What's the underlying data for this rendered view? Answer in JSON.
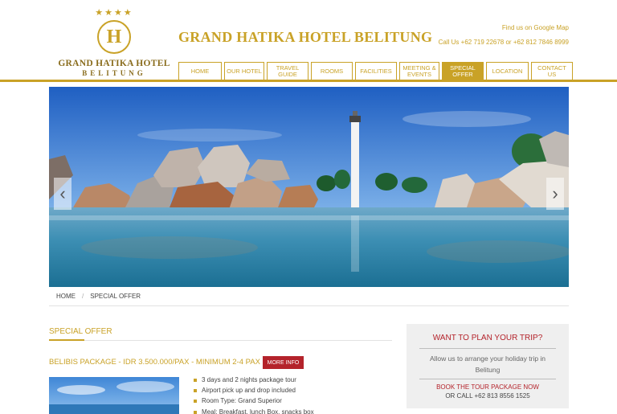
{
  "logo": {
    "stars": "★★★★",
    "letter": "H",
    "name_line1": "GRAND HATIKA HOTEL",
    "name_line2": "BELITUNG"
  },
  "header": {
    "title": "GRAND HATIKA HOTEL BELITUNG",
    "map_link": "Find us on Google Map",
    "call": "Call Us +62 719 22678 or +62 812 7846 8999"
  },
  "nav": {
    "home": "HOME",
    "our_hotel": "OUR HOTEL",
    "travel_guide_1": "TRAVEL",
    "travel_guide_2": "GUIDE",
    "rooms": "ROOMS",
    "facilities": "FACILITIES",
    "meeting_1": "MEETING &",
    "meeting_2": "EVENTS",
    "special_1": "SPECIAL",
    "special_2": "OFFER",
    "location": "LOCATION",
    "contact_1": "CONTACT",
    "contact_2": "US",
    "active": "SPECIAL OFFER"
  },
  "slider": {
    "prev_icon": "chevron-left-icon",
    "next_icon": "chevron-right-icon",
    "prev_glyph": "‹",
    "next_glyph": "›"
  },
  "breadcrumb": {
    "home": "HOME",
    "separator": "/",
    "current": "SPECIAL OFFER"
  },
  "content": {
    "section_title": "SPECIAL OFFER",
    "package_title": "BELIBIS PACKAGE - IDR 3.500.000/PAX - MINIMUM 2-4 PAX",
    "more_info": "MORE INFO",
    "features": [
      "3 days and 2 nights package tour",
      "Airport pick up and drop included",
      "Room Type: Grand Superior",
      "Meal: Breakfast, lunch Box, snacks box"
    ]
  },
  "plan_box": {
    "title": "WANT TO PLAN YOUR TRIP?",
    "description": "Allow us to arrange your holiday trip in Belitung",
    "book_link": "BOOK THE TOUR PACKAGE NOW",
    "phone": "OR CALL +62 813 8556 1525"
  },
  "colors": {
    "gold": "#c9a227",
    "red": "#b4232b",
    "sidebar_bg": "#efefef"
  }
}
